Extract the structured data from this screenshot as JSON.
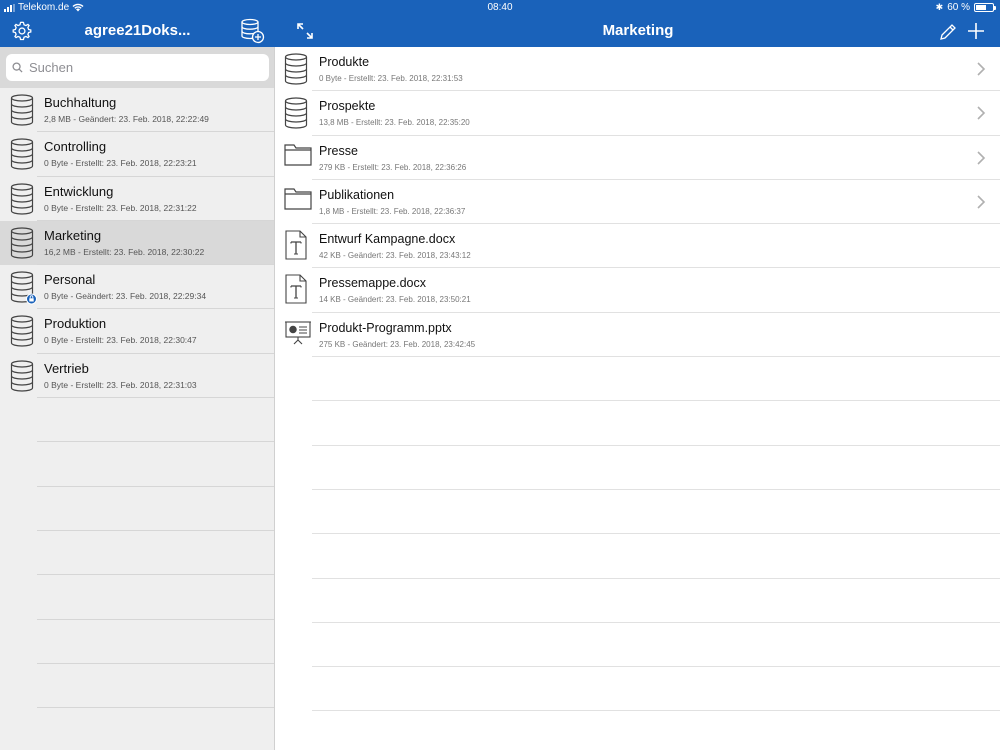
{
  "status_bar": {
    "carrier": "Telekom.de",
    "time": "08:40",
    "battery": "60 %",
    "battery_level": 0.6
  },
  "left_header": {
    "title": "agree21Doks...",
    "settings_icon": "gear-icon",
    "add_database_icon": "database-add-icon"
  },
  "right_header": {
    "title": "Marketing",
    "expand_icon": "expand-icon",
    "edit_icon": "pencil-icon",
    "add_icon": "plus-icon"
  },
  "search": {
    "placeholder": "Suchen"
  },
  "databases": [
    {
      "name": "Buchhaltung",
      "meta": "2,8 MB - Geändert: 23. Feb. 2018, 22:22:49",
      "icon": "database-icon",
      "selected": false
    },
    {
      "name": "Controlling",
      "meta": "0 Byte - Erstellt: 23. Feb. 2018, 22:23:21",
      "icon": "database-icon",
      "selected": false
    },
    {
      "name": "Entwicklung",
      "meta": "0 Byte - Erstellt: 23. Feb. 2018, 22:31:22",
      "icon": "database-icon",
      "selected": false
    },
    {
      "name": "Marketing",
      "meta": "16,2 MB - Erstellt: 23. Feb. 2018, 22:30:22",
      "icon": "database-icon",
      "selected": true
    },
    {
      "name": "Personal",
      "meta": "0 Byte - Geändert: 23. Feb. 2018, 22:29:34",
      "icon": "database-locked-icon",
      "selected": false
    },
    {
      "name": "Produktion",
      "meta": "0 Byte - Erstellt: 23. Feb. 2018, 22:30:47",
      "icon": "database-icon",
      "selected": false
    },
    {
      "name": "Vertrieb",
      "meta": "0 Byte - Erstellt: 23. Feb. 2018, 22:31:03",
      "icon": "database-icon",
      "selected": false
    }
  ],
  "items": [
    {
      "name": "Produkte",
      "meta": "0 Byte - Erstellt: 23. Feb. 2018, 22:31:53",
      "icon": "database-icon",
      "chevron": true
    },
    {
      "name": "Prospekte",
      "meta": "13,8 MB - Erstellt: 23. Feb. 2018, 22:35:20",
      "icon": "database-icon",
      "chevron": true
    },
    {
      "name": "Presse",
      "meta": "279 KB - Erstellt: 23. Feb. 2018, 22:36:26",
      "icon": "folder-icon",
      "chevron": true
    },
    {
      "name": "Publikationen",
      "meta": "1,8 MB - Erstellt: 23. Feb. 2018, 22:36:37",
      "icon": "folder-icon",
      "chevron": true
    },
    {
      "name": "Entwurf Kampagne.docx",
      "meta": "42 KB - Geändert: 23. Feb. 2018, 23:43:12",
      "icon": "text-document-icon",
      "chevron": false
    },
    {
      "name": "Pressemappe.docx",
      "meta": "14 KB - Geändert: 23. Feb. 2018, 23:50:21",
      "icon": "text-document-icon",
      "chevron": false
    },
    {
      "name": "Produkt-Programm.pptx",
      "meta": "275 KB - Geändert: 23. Feb. 2018, 23:42:45",
      "icon": "presentation-icon",
      "chevron": false
    }
  ],
  "colors": {
    "header_blue": "#1a62ba",
    "selected_row": "#d9d9d9",
    "badge_blue": "#1a62ba"
  }
}
